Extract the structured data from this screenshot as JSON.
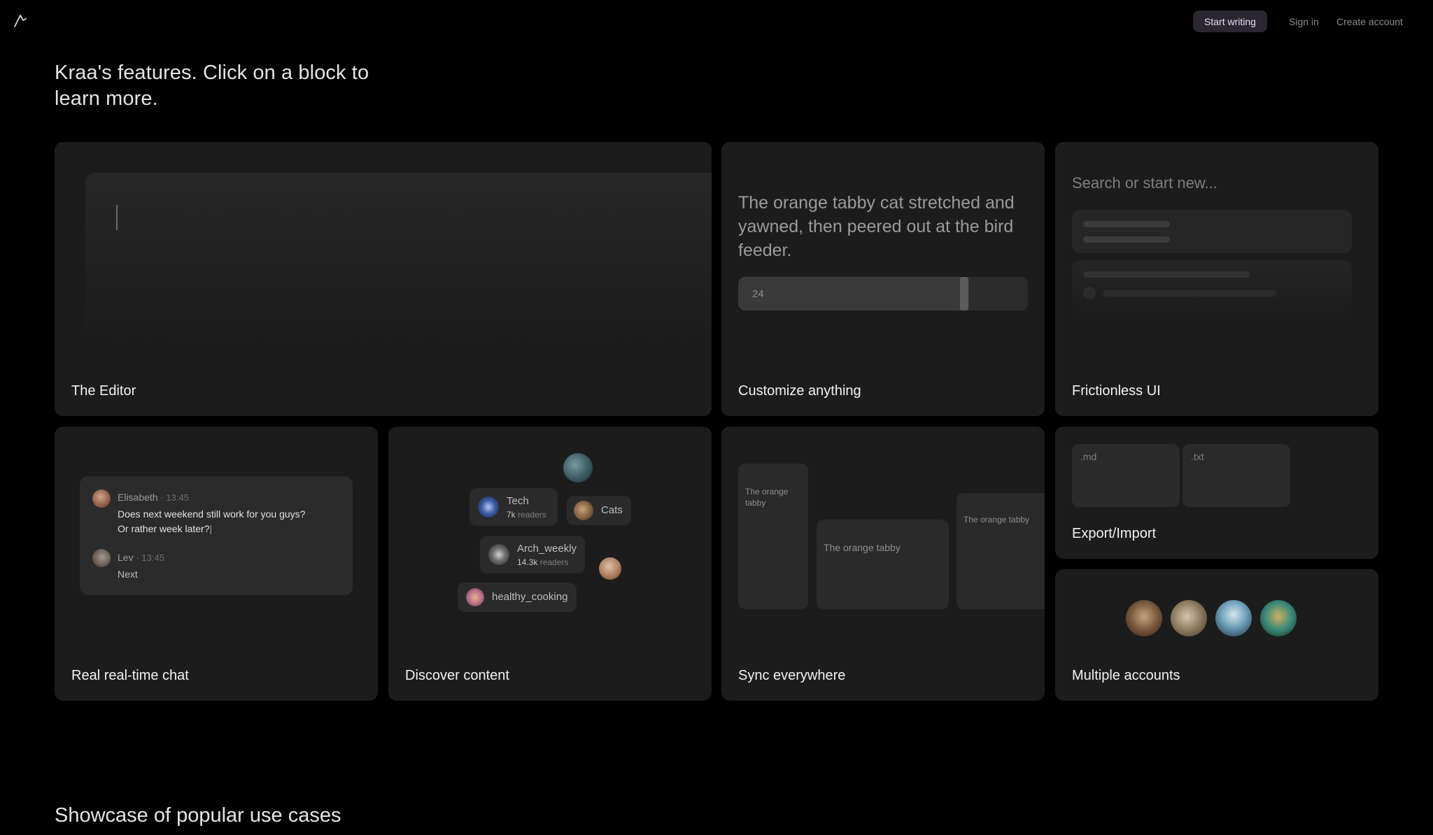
{
  "header": {
    "logo_icon": "kraa-logo-icon",
    "start_writing": "Start writing",
    "sign_in": "Sign in",
    "create_account": "Create account"
  },
  "headline": "Kraa's features. Click on a block to learn more.",
  "cards": {
    "editor": {
      "title": "The Editor"
    },
    "customize": {
      "title": "Customize anything",
      "sample_text": "The orange tabby cat stretched and yawned, then peered out at the bird feeder.",
      "slider_value": "24",
      "slider_fill": 0.78
    },
    "frictionless": {
      "title": "Frictionless UI",
      "search_placeholder": "Search or start new..."
    },
    "chat": {
      "title": "Real real-time chat",
      "messages": [
        {
          "name": "Elisabeth",
          "time": "· 13:45",
          "lines": [
            "Does next weekend still work for you guys?",
            "Or rather week later?"
          ]
        },
        {
          "name": "Lev",
          "time": "· 13:45",
          "lines": [
            "Next"
          ]
        }
      ]
    },
    "discover": {
      "title": "Discover content",
      "chips": [
        {
          "title": "Tech",
          "count": "7k",
          "suffix": " readers"
        },
        {
          "title": "Cats"
        },
        {
          "title": "Arch_weekly",
          "count": "14.3k",
          "suffix": " readers"
        },
        {
          "title": "healthy_cooking"
        }
      ]
    },
    "sync": {
      "title": "Sync everywhere",
      "panels": [
        "The orange tabby",
        "The orange tabby",
        "The orange tabby"
      ]
    },
    "export": {
      "title": "Export/Import",
      "formats": [
        ".md",
        ".txt"
      ]
    },
    "accounts": {
      "title": "Multiple accounts"
    }
  },
  "showcase_title": "Showcase of popular use cases"
}
